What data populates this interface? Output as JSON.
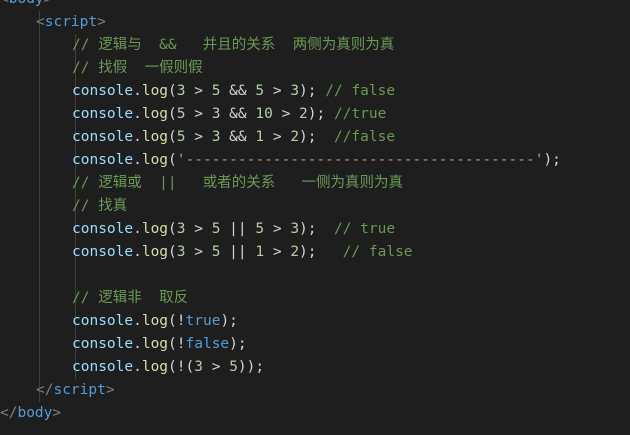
{
  "editor": {
    "theme": {
      "background": "#1e1e1e",
      "default": "#d4d4d4",
      "bracket": "#808080",
      "tag": "#569cd6",
      "comment": "#6a9955",
      "identifier": "#9cdcfe",
      "function": "#dcdcaa",
      "number": "#b5cea8",
      "string": "#ce9178",
      "boolean": "#569cd6"
    },
    "lines": [
      {
        "indent": 0,
        "tokens": [
          {
            "t": "bracket",
            "v": "<"
          },
          {
            "t": "tag",
            "v": "body"
          },
          {
            "t": "bracket",
            "v": ">"
          }
        ]
      },
      {
        "indent": 1,
        "tokens": [
          {
            "t": "bracket",
            "v": "<"
          },
          {
            "t": "tag",
            "v": "script"
          },
          {
            "t": "bracket",
            "v": ">"
          }
        ]
      },
      {
        "indent": 2,
        "tokens": [
          {
            "t": "comment",
            "v": "// 逻辑与  &&   并且的关系  两侧为真则为真"
          }
        ]
      },
      {
        "indent": 2,
        "tokens": [
          {
            "t": "comment",
            "v": "// 找假  一假则假"
          }
        ]
      },
      {
        "indent": 2,
        "tokens": [
          {
            "t": "ident",
            "v": "console"
          },
          {
            "t": "punct",
            "v": "."
          },
          {
            "t": "func",
            "v": "log"
          },
          {
            "t": "punct",
            "v": "("
          },
          {
            "t": "number",
            "v": "3"
          },
          {
            "t": "op",
            "v": " > "
          },
          {
            "t": "number",
            "v": "5"
          },
          {
            "t": "op",
            "v": " && "
          },
          {
            "t": "number",
            "v": "5"
          },
          {
            "t": "op",
            "v": " > "
          },
          {
            "t": "number",
            "v": "3"
          },
          {
            "t": "punct",
            "v": "); "
          },
          {
            "t": "comment",
            "v": "// false"
          }
        ]
      },
      {
        "indent": 2,
        "tokens": [
          {
            "t": "ident",
            "v": "console"
          },
          {
            "t": "punct",
            "v": "."
          },
          {
            "t": "func",
            "v": "log"
          },
          {
            "t": "punct",
            "v": "("
          },
          {
            "t": "number",
            "v": "5"
          },
          {
            "t": "op",
            "v": " > "
          },
          {
            "t": "number",
            "v": "3"
          },
          {
            "t": "op",
            "v": " && "
          },
          {
            "t": "number",
            "v": "10"
          },
          {
            "t": "op",
            "v": " > "
          },
          {
            "t": "number",
            "v": "2"
          },
          {
            "t": "punct",
            "v": "); "
          },
          {
            "t": "comment",
            "v": "//true"
          }
        ]
      },
      {
        "indent": 2,
        "tokens": [
          {
            "t": "ident",
            "v": "console"
          },
          {
            "t": "punct",
            "v": "."
          },
          {
            "t": "func",
            "v": "log"
          },
          {
            "t": "punct",
            "v": "("
          },
          {
            "t": "number",
            "v": "5"
          },
          {
            "t": "op",
            "v": " > "
          },
          {
            "t": "number",
            "v": "3"
          },
          {
            "t": "op",
            "v": " && "
          },
          {
            "t": "number",
            "v": "1"
          },
          {
            "t": "op",
            "v": " > "
          },
          {
            "t": "number",
            "v": "2"
          },
          {
            "t": "punct",
            "v": ");  "
          },
          {
            "t": "comment",
            "v": "//false"
          }
        ]
      },
      {
        "indent": 2,
        "tokens": [
          {
            "t": "ident",
            "v": "console"
          },
          {
            "t": "punct",
            "v": "."
          },
          {
            "t": "func",
            "v": "log"
          },
          {
            "t": "punct",
            "v": "("
          },
          {
            "t": "string",
            "v": "'----------------------------------------'"
          },
          {
            "t": "punct",
            "v": ");"
          }
        ]
      },
      {
        "indent": 2,
        "tokens": [
          {
            "t": "comment",
            "v": "// 逻辑或  ||   或者的关系   一侧为真则为真"
          }
        ]
      },
      {
        "indent": 2,
        "tokens": [
          {
            "t": "comment",
            "v": "// 找真"
          }
        ]
      },
      {
        "indent": 2,
        "tokens": [
          {
            "t": "ident",
            "v": "console"
          },
          {
            "t": "punct",
            "v": "."
          },
          {
            "t": "func",
            "v": "log"
          },
          {
            "t": "punct",
            "v": "("
          },
          {
            "t": "number",
            "v": "3"
          },
          {
            "t": "op",
            "v": " > "
          },
          {
            "t": "number",
            "v": "5"
          },
          {
            "t": "op",
            "v": " || "
          },
          {
            "t": "number",
            "v": "5"
          },
          {
            "t": "op",
            "v": " > "
          },
          {
            "t": "number",
            "v": "3"
          },
          {
            "t": "punct",
            "v": ");  "
          },
          {
            "t": "comment",
            "v": "// true"
          }
        ]
      },
      {
        "indent": 2,
        "tokens": [
          {
            "t": "ident",
            "v": "console"
          },
          {
            "t": "punct",
            "v": "."
          },
          {
            "t": "func",
            "v": "log"
          },
          {
            "t": "punct",
            "v": "("
          },
          {
            "t": "number",
            "v": "3"
          },
          {
            "t": "op",
            "v": " > "
          },
          {
            "t": "number",
            "v": "5"
          },
          {
            "t": "op",
            "v": " || "
          },
          {
            "t": "number",
            "v": "1"
          },
          {
            "t": "op",
            "v": " > "
          },
          {
            "t": "number",
            "v": "2"
          },
          {
            "t": "punct",
            "v": ");   "
          },
          {
            "t": "comment",
            "v": "// false"
          }
        ]
      },
      {
        "indent": 2,
        "tokens": []
      },
      {
        "indent": 2,
        "tokens": [
          {
            "t": "comment",
            "v": "// 逻辑非  取反"
          }
        ]
      },
      {
        "indent": 2,
        "tokens": [
          {
            "t": "ident",
            "v": "console"
          },
          {
            "t": "punct",
            "v": "."
          },
          {
            "t": "func",
            "v": "log"
          },
          {
            "t": "punct",
            "v": "("
          },
          {
            "t": "op",
            "v": "!"
          },
          {
            "t": "bool",
            "v": "true"
          },
          {
            "t": "punct",
            "v": ");"
          }
        ]
      },
      {
        "indent": 2,
        "tokens": [
          {
            "t": "ident",
            "v": "console"
          },
          {
            "t": "punct",
            "v": "."
          },
          {
            "t": "func",
            "v": "log"
          },
          {
            "t": "punct",
            "v": "("
          },
          {
            "t": "op",
            "v": "!"
          },
          {
            "t": "bool",
            "v": "false"
          },
          {
            "t": "punct",
            "v": ");"
          }
        ]
      },
      {
        "indent": 2,
        "tokens": [
          {
            "t": "ident",
            "v": "console"
          },
          {
            "t": "punct",
            "v": "."
          },
          {
            "t": "func",
            "v": "log"
          },
          {
            "t": "punct",
            "v": "("
          },
          {
            "t": "op",
            "v": "!("
          },
          {
            "t": "number",
            "v": "3"
          },
          {
            "t": "op",
            "v": " > "
          },
          {
            "t": "number",
            "v": "5"
          },
          {
            "t": "punct",
            "v": "));"
          }
        ]
      },
      {
        "indent": 1,
        "tokens": [
          {
            "t": "bracket",
            "v": "</"
          },
          {
            "t": "tag",
            "v": "script"
          },
          {
            "t": "bracket",
            "v": ">"
          }
        ]
      },
      {
        "indent": 0,
        "tokens": [
          {
            "t": "bracket",
            "v": "</"
          },
          {
            "t": "tag",
            "v": "body"
          },
          {
            "t": "bracket",
            "v": ">"
          }
        ]
      }
    ]
  }
}
